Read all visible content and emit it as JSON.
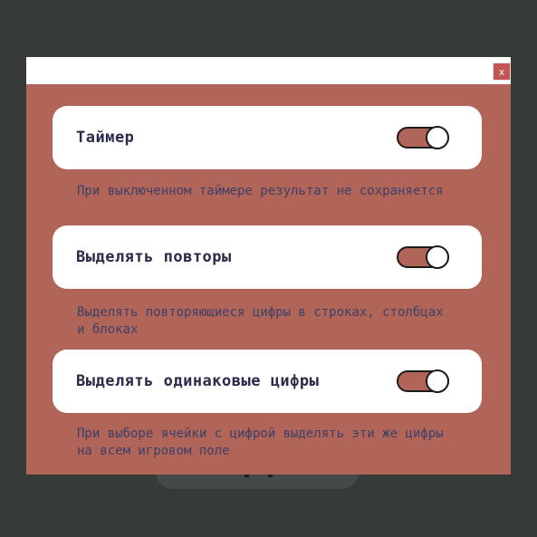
{
  "background_app": {
    "button_text": ""
  },
  "modal": {
    "close_label": "x",
    "settings": [
      {
        "label": "Таймер",
        "enabled": true,
        "description": "При выключенном таймере результат не сохраняется"
      },
      {
        "label": "Выделять повторы",
        "enabled": true,
        "description": "Выделять повторяющиеся цифры в строках, столбцах и блоках"
      },
      {
        "label": "Выделять одинаковые цифры",
        "enabled": true,
        "description": "При выборе ячейки с цифрой выделять эти же цифры на всем игровом поле"
      }
    ]
  },
  "colors": {
    "backdrop": "#363b37",
    "modal_body": "#b06558",
    "card": "#ffffff",
    "label_text": "#2a2a4a",
    "description_text": "#3f3f66",
    "close_button": "#c55552"
  }
}
